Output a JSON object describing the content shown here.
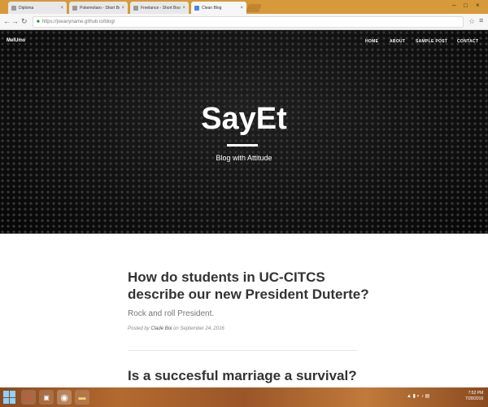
{
  "browser": {
    "tabs": [
      {
        "label": "Diploma"
      },
      {
        "label": "Pokemotaro - Short Boo"
      },
      {
        "label": "Freelance - Short Booth"
      },
      {
        "label": "Clean Blog",
        "active": true
      }
    ],
    "url": "https://joeanyname.github.io/blog/"
  },
  "site": {
    "brand": "MelUmo",
    "nav": [
      "HOME",
      "ABOUT",
      "SAMPLE POST",
      "CONTACT"
    ],
    "title": "SayEt",
    "subtitle": "Blog with Attitude"
  },
  "posts": [
    {
      "title": "How do students in UC-CITCS describe our new President Duterte?",
      "subtitle": "Rock and roll President.",
      "meta_prefix": "Posted by",
      "author": "Clade Boi",
      "meta_on": "on September 24, 2016"
    },
    {
      "title": "Is a succesful marriage a survival?"
    }
  ],
  "taskbar": {
    "time": "7:52 PM",
    "date": "7/28/2016"
  }
}
